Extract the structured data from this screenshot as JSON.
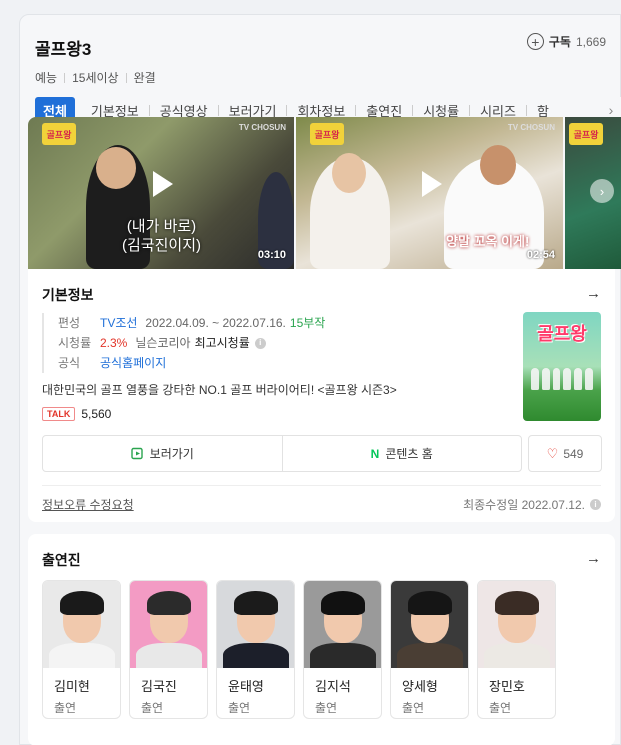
{
  "header": {
    "title": "골프왕3",
    "subscribe_label": "구독",
    "subscribe_count": "1,669",
    "meta": [
      "예능",
      "15세이상",
      "완결"
    ]
  },
  "tabs": [
    "전체",
    "기본정보",
    "공식영상",
    "보러가기",
    "회차정보",
    "출연진",
    "시청률",
    "시리즈",
    "함"
  ],
  "videos": [
    {
      "badge": "골프왕",
      "channel": "TV CHOSUN",
      "caption_line1": "(내가 바로)",
      "caption_line2": "(김국진이지)",
      "duration": "03:10"
    },
    {
      "badge": "골프왕",
      "channel": "TV CHOSUN",
      "caption": "양말 꼬옥 이게!",
      "duration": "02:54"
    },
    {
      "badge": "골프왕"
    }
  ],
  "info": {
    "section_title": "기본정보",
    "labels": {
      "air": "편성",
      "rating": "시청률",
      "official": "공식"
    },
    "channel": "TV조선",
    "period": "2022.04.09. ~ 2022.07.16.",
    "episodes": "15부작",
    "rating_value": "2.3%",
    "rating_source": "닐슨코리아",
    "rating_note": "최고시청률",
    "official_link": "공식홈페이지",
    "description": "대한민국의 골프 열풍을 강타한 NO.1 골프 버라이어티! <골프왕 시즌3>",
    "talk_badge": "TALK",
    "talk_count": "5,560",
    "poster_title": "골프왕",
    "watch_label": "보러가기",
    "contents_label": "콘텐츠 홈",
    "like_count": "549",
    "report_label": "정보오류 수정요청",
    "updated": "최종수정일 2022.07.12."
  },
  "cast": {
    "section_title": "출연진",
    "members": [
      {
        "name": "김미현",
        "role": "출연",
        "bg": "#e9e9e9",
        "hair": "#1a1a1a",
        "body": "#f4f4f4"
      },
      {
        "name": "김국진",
        "role": "출연",
        "bg": "#f39bc4",
        "hair": "#2b2b2b",
        "body": "#e8e8e8"
      },
      {
        "name": "윤태영",
        "role": "출연",
        "bg": "#d7d9dc",
        "hair": "#1b1b1b",
        "body": "#1c1f2a"
      },
      {
        "name": "김지석",
        "role": "출연",
        "bg": "#9a9a9a",
        "hair": "#111111",
        "body": "#2a2a2a"
      },
      {
        "name": "양세형",
        "role": "출연",
        "bg": "#3a3a3a",
        "hair": "#151515",
        "body": "#4a3e34"
      },
      {
        "name": "장민호",
        "role": "출연",
        "bg": "#eee6e6",
        "hair": "#3a2c25",
        "body": "#ece9e4"
      }
    ]
  },
  "colors": {
    "accent": "#1f6fd8",
    "green": "#2aa44f",
    "red": "#e2352a"
  },
  "icons": [
    "plus-circle-icon",
    "chevron-right-icon",
    "play-icon",
    "arrow-right-icon",
    "watch-icon",
    "naver-n-icon",
    "heart-icon",
    "info-icon"
  ]
}
